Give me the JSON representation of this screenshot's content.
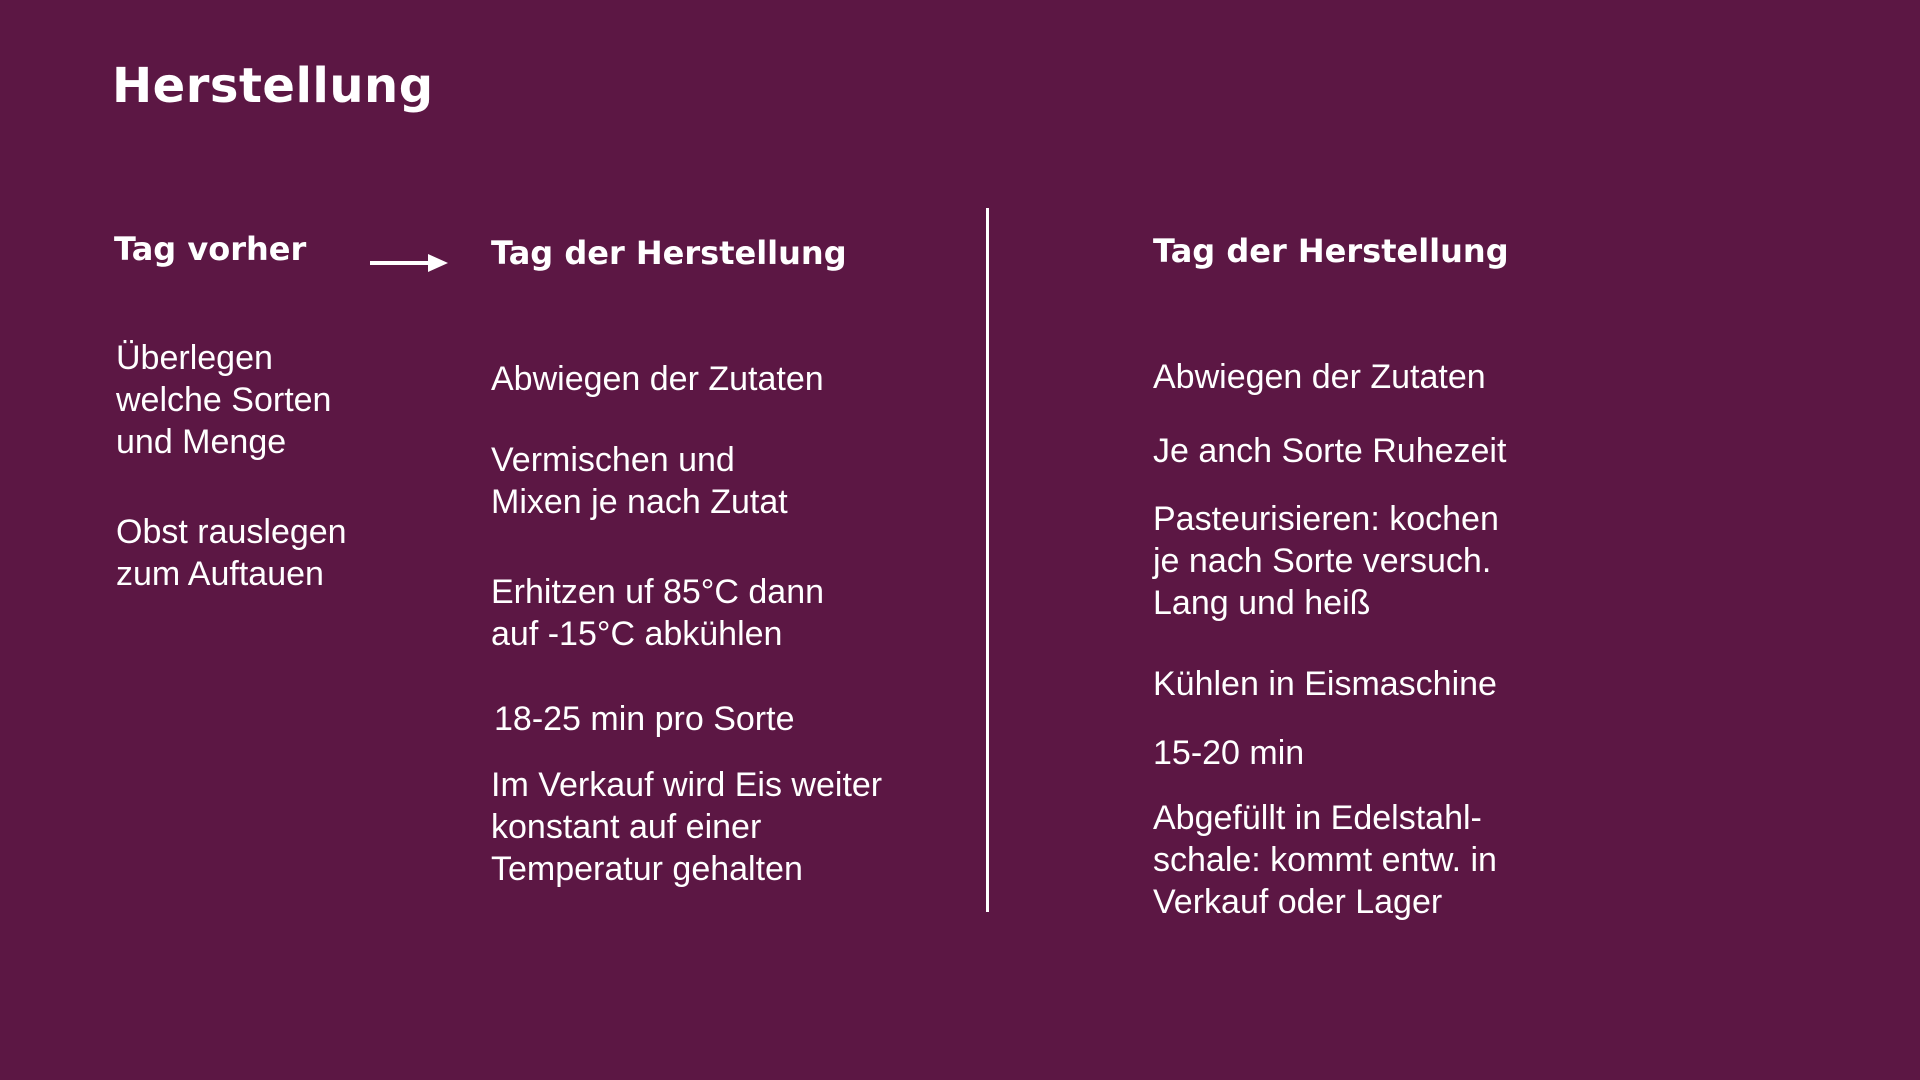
{
  "slide": {
    "title": "Herstellung",
    "left": {
      "heading": "Tag vorher",
      "items": [
        "Überlegen\nwelche Sorten\nund Menge",
        "Obst rauslegen\nzum Auftauen"
      ]
    },
    "middle": {
      "heading": "Tag der Herstellung",
      "items": [
        "Abwiegen der Zutaten",
        "Vermischen und\nMixen je nach Zutat",
        "Erhitzen uf 85°C dann\nauf -15°C abkühlen",
        "18-25 min pro Sorte",
        "Im Verkauf wird Eis weiter\nkonstant auf einer\nTemperatur gehalten"
      ]
    },
    "right": {
      "heading": "Tag der Herstellung",
      "items": [
        "Abwiegen der Zutaten",
        "Je anch Sorte Ruhezeit",
        "Pasteurisieren: kochen\nje nach Sorte versuch.\nLang und heiß",
        "Kühlen in Eismaschine",
        "15-20 min",
        "Abgefüllt in Edelstahl-\nschale: kommt entw. in\nVerkauf oder Lager"
      ]
    },
    "icons": {
      "arrow": "arrow-right-icon",
      "divider": "vertical-divider"
    },
    "colors": {
      "background": "#5c1744",
      "text": "#ffffff"
    }
  }
}
